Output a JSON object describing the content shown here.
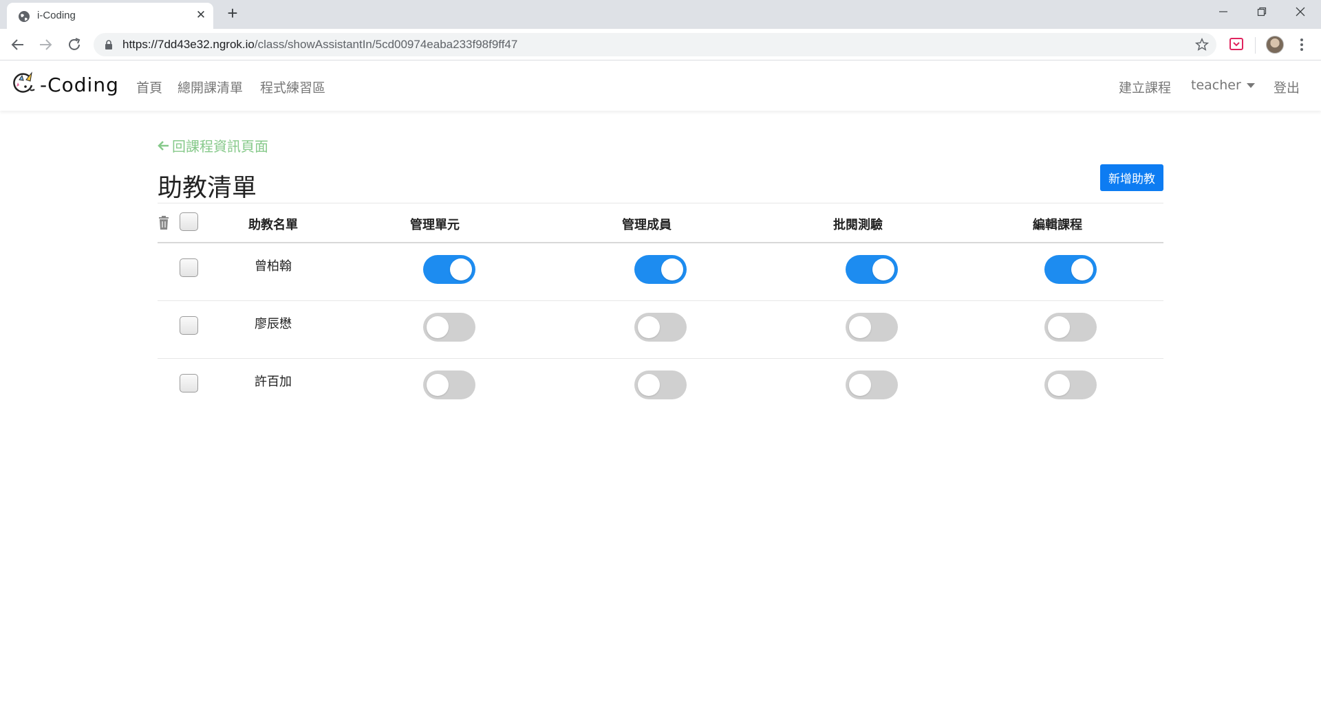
{
  "browser": {
    "tab_title": "i-Coding",
    "url_host": "https://7dd43e32.ngrok.io",
    "url_path": "/class/showAssistantIn/5cd00974eaba233f98f9ff47"
  },
  "navbar": {
    "logo_text": "-Coding",
    "links": [
      "首頁",
      "總開課清單",
      "程式練習區"
    ],
    "create_course": "建立課程",
    "user": "teacher",
    "logout": "登出"
  },
  "page": {
    "back_link": "回課程資訊頁面",
    "title": "助教清單",
    "add_button": "新增助教"
  },
  "table": {
    "headers": [
      "助教名單",
      "管理單元",
      "管理成員",
      "批閱測驗",
      "編輯課程"
    ],
    "rows": [
      {
        "name": "曾柏翰",
        "perms": [
          true,
          true,
          true,
          true
        ],
        "checked": false
      },
      {
        "name": "廖辰懋",
        "perms": [
          false,
          false,
          false,
          false
        ],
        "checked": false
      },
      {
        "name": "許百加",
        "perms": [
          false,
          false,
          false,
          false
        ],
        "checked": false
      }
    ]
  },
  "colors": {
    "accent": "#1d8cf0",
    "button": "#0d7cf2",
    "back_link": "#86c98a",
    "switch_off": "#d0d0d0"
  }
}
